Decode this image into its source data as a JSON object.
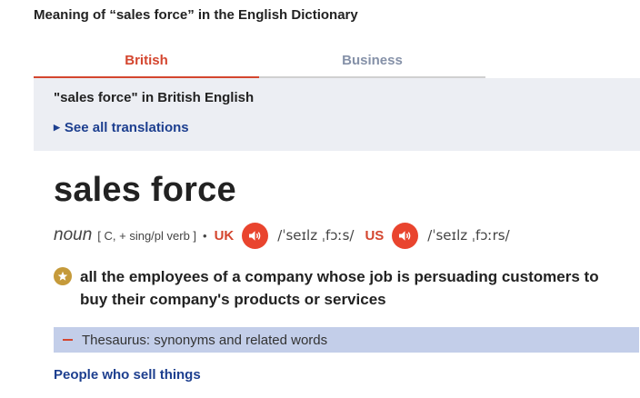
{
  "page": {
    "heading": "Meaning of “sales force” in the English Dictionary"
  },
  "tabs": [
    {
      "label": "British",
      "active": true
    },
    {
      "label": "Business",
      "active": false
    }
  ],
  "entry_panel": {
    "title": "\"sales force\" in British English",
    "see_all_label": "See all translations"
  },
  "entry": {
    "headword": "sales force",
    "pos": "noun",
    "grammar": "[ C, + sing/pl verb ]",
    "separator": "•",
    "uk_label": "UK",
    "uk_ipa": "/ˈseɪlz ˌfɔːs/",
    "us_label": "US",
    "us_ipa": "/ˈseɪlz ˌfɔːrs/",
    "definition": "all the employees of a company whose job is persuading customers to buy their company's products or services",
    "thesaurus_label": "Thesaurus: synonyms and related words",
    "related_heading": "People who sell things"
  },
  "colors": {
    "accent_red": "#d4462f",
    "link_blue": "#1d3f8f",
    "panel_bg": "#eceef3",
    "thesaurus_bg": "#c3cee9",
    "star_gold": "#c59a3a"
  },
  "icons": {
    "audio": "speaker-icon",
    "definition_marker": "star-icon",
    "see_all": "triangle-right-icon",
    "thesaurus": "minus-icon"
  }
}
